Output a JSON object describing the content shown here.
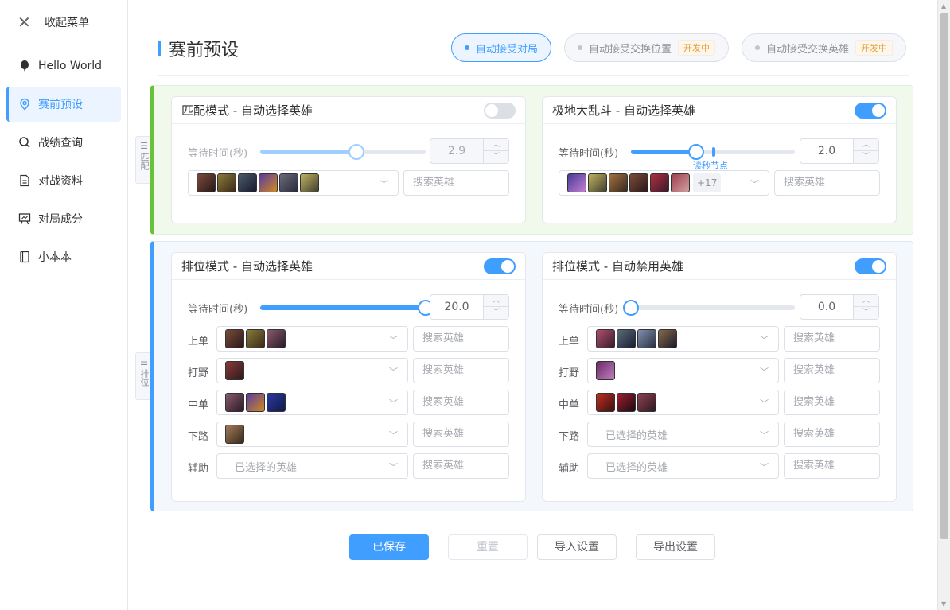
{
  "sidebar": {
    "collapse_label": "收起菜单",
    "items": [
      {
        "label": "Hello World",
        "icon": "balloon-icon"
      },
      {
        "label": "赛前预设",
        "icon": "location-icon",
        "active": true
      },
      {
        "label": "战绩查询",
        "icon": "search-icon"
      },
      {
        "label": "对战资料",
        "icon": "document-icon"
      },
      {
        "label": "对局成分",
        "icon": "presentation-icon"
      },
      {
        "label": "小本本",
        "icon": "notebook-icon"
      }
    ]
  },
  "page": {
    "title": "赛前预设",
    "pills": [
      {
        "label": "自动接受对局",
        "active": true,
        "badge": ""
      },
      {
        "label": "自动接受交换位置",
        "active": false,
        "badge": "开发中"
      },
      {
        "label": "自动接受交换英雄",
        "active": false,
        "badge": "开发中"
      }
    ]
  },
  "groups": {
    "match_handle": "匹配",
    "rank_handle": "排位"
  },
  "common": {
    "wait_label": "等待时间(秒)",
    "search_placeholder": "搜索英雄",
    "selected_placeholder": "已选择的英雄",
    "read_node_label": "读秒节点"
  },
  "cards": {
    "normal_pick": {
      "title": "匹配模式 - 自动选择英雄",
      "enabled": false,
      "wait": "2.9",
      "wait_fraction": 0.58
    },
    "aram_pick": {
      "title": "极地大乱斗 - 自动选择英雄",
      "enabled": true,
      "wait": "2.0",
      "wait_fraction": 0.4,
      "more": "+17"
    },
    "rank_pick": {
      "title": "排位模式 - 自动选择英雄",
      "enabled": true,
      "wait": "20.0",
      "wait_fraction": 1.0,
      "roles": [
        {
          "label": "上单",
          "count": 3
        },
        {
          "label": "打野",
          "count": 1
        },
        {
          "label": "中单",
          "count": 3
        },
        {
          "label": "下路",
          "count": 1
        },
        {
          "label": "辅助",
          "count": 0
        }
      ]
    },
    "rank_ban": {
      "title": "排位模式 - 自动禁用英雄",
      "enabled": true,
      "wait": "0.0",
      "wait_fraction": 0.0,
      "roles": [
        {
          "label": "上单",
          "count": 4
        },
        {
          "label": "打野",
          "count": 1
        },
        {
          "label": "中单",
          "count": 3
        },
        {
          "label": "下路",
          "count": 0
        },
        {
          "label": "辅助",
          "count": 0
        }
      ]
    }
  },
  "actions": {
    "save": "已保存",
    "reset": "重置",
    "import": "导入设置",
    "export": "导出设置"
  },
  "colors": {
    "accent": "#409eff",
    "match_group": "#67c23a",
    "badge": "#e6a23c"
  }
}
